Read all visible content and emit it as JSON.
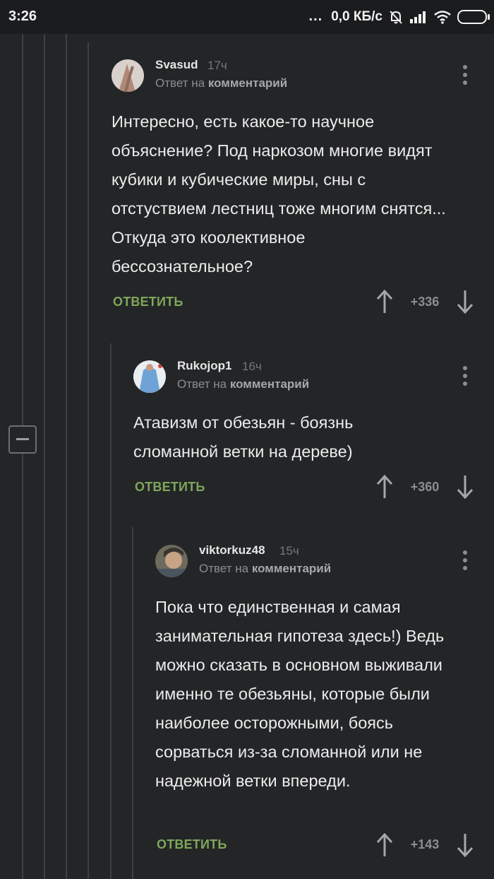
{
  "status_bar": {
    "time": "3:26",
    "more_dots": "...",
    "net_speed": "0,0 КБ/с",
    "icons": [
      "bell-off-icon",
      "signal-icon",
      "wifi-icon",
      "battery-icon"
    ]
  },
  "colors": {
    "background": "#232527",
    "reply_action": "#7fa65a",
    "thread_line": "#3d4044"
  },
  "comments": [
    {
      "author": "Svasud",
      "time": "17ч",
      "reply_prefix": "Ответ на",
      "reply_target": "комментарий",
      "text": "Интересно, есть какое-то научное объяснение? Под наркозом многие видят кубики и кубические миры, сны с отстуствием лестниц тоже многим снятся... Откуда это коолективное бессознательное?",
      "reply_label": "ОТВЕТИТЬ",
      "score": "+336"
    },
    {
      "author": "Rukojop1",
      "time": "16ч",
      "reply_prefix": "Ответ на",
      "reply_target": "комментарий",
      "text": "Атавизм от обезьян - боязнь сломанной ветки на дереве)",
      "reply_label": "ОТВЕТИТЬ",
      "score": "+360"
    },
    {
      "author": "viktorkuz48",
      "time": "15ч",
      "reply_prefix": "Ответ на",
      "reply_target": "комментарий",
      "text": "Пока что единственная и самая занимательная гипотеза здесь!) Ведь можно сказать в основном выживали именно те обезьяны, которые были наиболее осторожными, боясь сорваться из-за сломанной или не надежной ветки впереди.",
      "reply_label": "ОТВЕТИТЬ",
      "score": "+143"
    }
  ]
}
